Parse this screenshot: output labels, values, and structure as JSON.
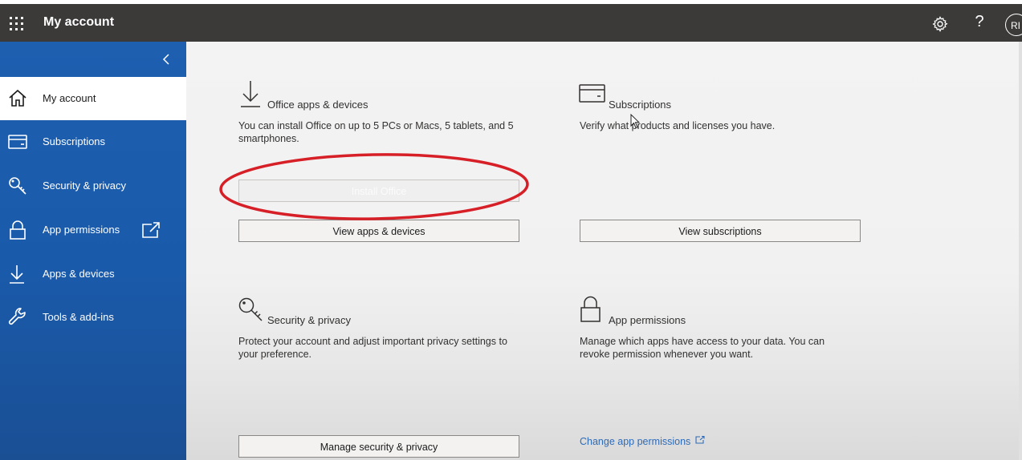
{
  "header": {
    "title": "My account",
    "waffle_icon": "app-launcher-icon",
    "settings_icon": "gear-icon",
    "help_label": "?",
    "avatar_initials": "RI"
  },
  "sidebar": {
    "collapse_icon": "chevron-left-icon",
    "items": [
      {
        "label": "My account",
        "icon": "home-icon",
        "active": true
      },
      {
        "label": "Subscriptions",
        "icon": "card-icon"
      },
      {
        "label": "Security & privacy",
        "icon": "key-icon"
      },
      {
        "label": "App permissions",
        "icon": "lock-icon",
        "external_icon": "open-external-icon"
      },
      {
        "label": "Apps & devices",
        "icon": "download-icon"
      },
      {
        "label": "Tools & add-ins",
        "icon": "wrench-icon"
      }
    ]
  },
  "cards": {
    "office": {
      "title": "Office apps & devices",
      "description": "You can install Office on up to 5 PCs or Macs, 5 tablets, and 5 smartphones.",
      "install_label": "Install Office",
      "view_label": "View apps & devices"
    },
    "subscriptions": {
      "title": "Subscriptions",
      "description": "Verify what products and licenses you have.",
      "view_label": "View subscriptions"
    },
    "security": {
      "title": "Security & privacy",
      "description": "Protect your account and adjust important privacy settings to your preference.",
      "manage_label": "Manage security & privacy"
    },
    "permissions": {
      "title": "App permissions",
      "description": "Manage which apps have access to your data. You can revoke permission whenever you want.",
      "link_label": "Change app permissions"
    }
  },
  "colors": {
    "topbar": "#3b3a39",
    "sidebar": "#1e5fb0",
    "annotation_circle": "#d61f26",
    "link": "#2e6bb8"
  }
}
